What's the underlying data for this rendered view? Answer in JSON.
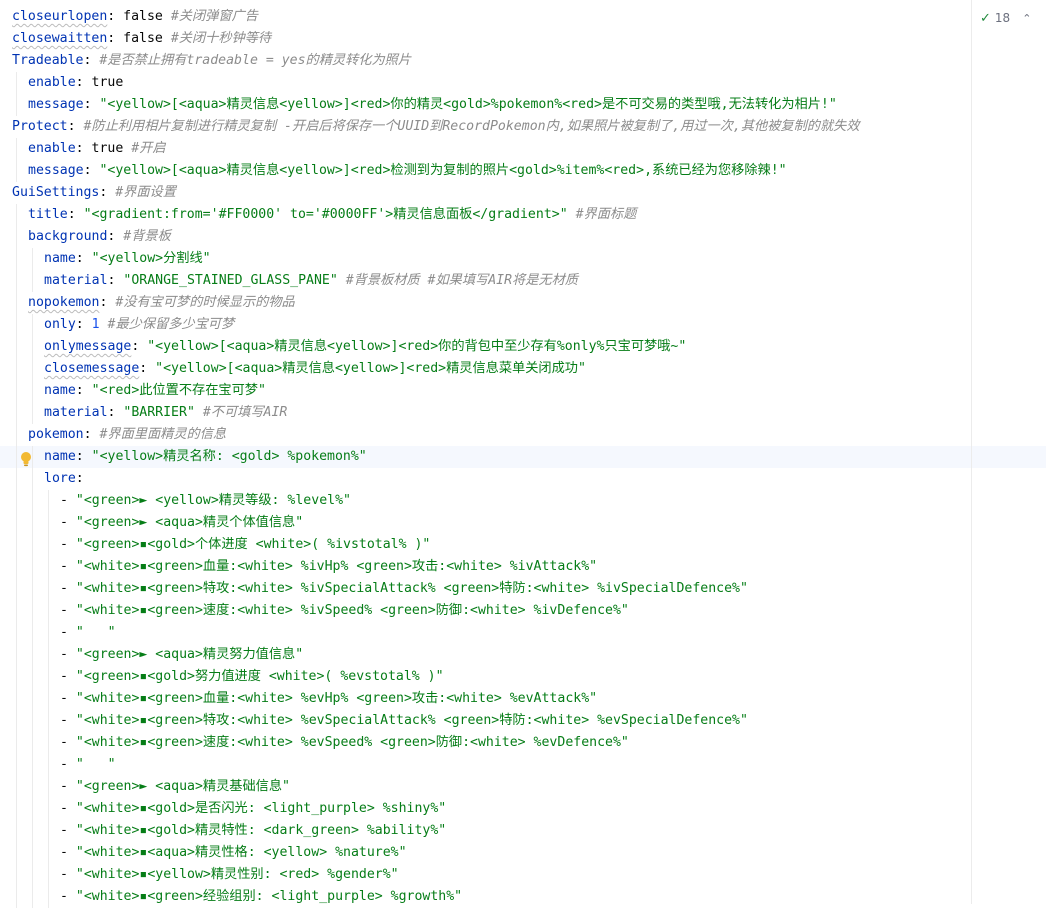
{
  "editor": {
    "inspection_count": "18",
    "lines": [
      {
        "indent": 0,
        "tokens": [
          {
            "t": "k",
            "v": "closeurlopen",
            "wavy": true
          },
          {
            "t": "v",
            "v": ": "
          },
          {
            "t": "v",
            "v": "false "
          },
          {
            "t": "c",
            "v": "#关闭弹窗广告"
          }
        ]
      },
      {
        "indent": 0,
        "tokens": [
          {
            "t": "k",
            "v": "closewaitten",
            "wavy": true
          },
          {
            "t": "v",
            "v": ": "
          },
          {
            "t": "v",
            "v": "false "
          },
          {
            "t": "c",
            "v": "#关闭十秒钟等待"
          }
        ]
      },
      {
        "indent": 0,
        "tokens": [
          {
            "t": "k",
            "v": "Tradeable"
          },
          {
            "t": "v",
            "v": ": "
          },
          {
            "t": "c",
            "v": "#是否禁止拥有tradeable = yes的精灵转化为照片"
          }
        ]
      },
      {
        "indent": 1,
        "tokens": [
          {
            "t": "k",
            "v": "enable"
          },
          {
            "t": "v",
            "v": ": "
          },
          {
            "t": "v",
            "v": "true"
          }
        ]
      },
      {
        "indent": 1,
        "tokens": [
          {
            "t": "k",
            "v": "message"
          },
          {
            "t": "v",
            "v": ": "
          },
          {
            "t": "s",
            "v": "\"<yellow>[<aqua>精灵信息<yellow>]<red>你的精灵<gold>%pokemon%<red>是不可交易的类型哦,无法转化为相片!\""
          }
        ]
      },
      {
        "indent": 0,
        "tokens": [
          {
            "t": "k",
            "v": "Protect"
          },
          {
            "t": "v",
            "v": ": "
          },
          {
            "t": "c",
            "v": "#防止利用相片复制进行精灵复制 -开启后将保存一个UUID到RecordPokemon内,如果照片被复制了,用过一次,其他被复制的就失效"
          }
        ]
      },
      {
        "indent": 1,
        "tokens": [
          {
            "t": "k",
            "v": "enable"
          },
          {
            "t": "v",
            "v": ": "
          },
          {
            "t": "v",
            "v": "true "
          },
          {
            "t": "c",
            "v": "#开启"
          }
        ]
      },
      {
        "indent": 1,
        "tokens": [
          {
            "t": "k",
            "v": "message"
          },
          {
            "t": "v",
            "v": ": "
          },
          {
            "t": "s",
            "v": "\"<yellow>[<aqua>精灵信息<yellow>]<red>检测到为复制的照片<gold>%item%<red>,系统已经为您移除辣!\""
          }
        ]
      },
      {
        "indent": 0,
        "tokens": [
          {
            "t": "k",
            "v": "GuiSettings"
          },
          {
            "t": "v",
            "v": ": "
          },
          {
            "t": "c",
            "v": "#界面设置"
          }
        ]
      },
      {
        "indent": 1,
        "tokens": [
          {
            "t": "k",
            "v": "title"
          },
          {
            "t": "v",
            "v": ": "
          },
          {
            "t": "s",
            "v": "\"<gradient:from='#FF0000' to='#0000FF'>精灵信息面板</gradient>\" "
          },
          {
            "t": "c",
            "v": "#界面标题"
          }
        ]
      },
      {
        "indent": 1,
        "tokens": [
          {
            "t": "k",
            "v": "background"
          },
          {
            "t": "v",
            "v": ": "
          },
          {
            "t": "c",
            "v": "#背景板"
          }
        ]
      },
      {
        "indent": 2,
        "tokens": [
          {
            "t": "k",
            "v": "name"
          },
          {
            "t": "v",
            "v": ": "
          },
          {
            "t": "s",
            "v": "\"<yellow>分割线\""
          }
        ]
      },
      {
        "indent": 2,
        "tokens": [
          {
            "t": "k",
            "v": "material"
          },
          {
            "t": "v",
            "v": ": "
          },
          {
            "t": "s",
            "v": "\"ORANGE_STAINED_GLASS_PANE\" "
          },
          {
            "t": "c",
            "v": "#背景板材质 #如果填写AIR将是无材质"
          }
        ]
      },
      {
        "indent": 1,
        "tokens": [
          {
            "t": "k",
            "v": "nopokemon",
            "wavy": true
          },
          {
            "t": "v",
            "v": ": "
          },
          {
            "t": "c",
            "v": "#没有宝可梦的时候显示的物品"
          }
        ]
      },
      {
        "indent": 2,
        "tokens": [
          {
            "t": "k",
            "v": "only"
          },
          {
            "t": "v",
            "v": ": "
          },
          {
            "t": "n",
            "v": "1 "
          },
          {
            "t": "c",
            "v": "#最少保留多少宝可梦"
          }
        ]
      },
      {
        "indent": 2,
        "tokens": [
          {
            "t": "k",
            "v": "onlymessage",
            "wavy": true
          },
          {
            "t": "v",
            "v": ": "
          },
          {
            "t": "s",
            "v": "\"<yellow>[<aqua>精灵信息<yellow>]<red>你的背包中至少存有%only%只宝可梦哦~\""
          }
        ]
      },
      {
        "indent": 2,
        "tokens": [
          {
            "t": "k",
            "v": "closemessage",
            "wavy": true
          },
          {
            "t": "v",
            "v": ": "
          },
          {
            "t": "s",
            "v": "\"<yellow>[<aqua>精灵信息<yellow>]<red>精灵信息菜单关闭成功\""
          }
        ]
      },
      {
        "indent": 2,
        "tokens": [
          {
            "t": "k",
            "v": "name"
          },
          {
            "t": "v",
            "v": ": "
          },
          {
            "t": "s",
            "v": "\"<red>此位置不存在宝可梦\""
          }
        ]
      },
      {
        "indent": 2,
        "tokens": [
          {
            "t": "k",
            "v": "material"
          },
          {
            "t": "v",
            "v": ": "
          },
          {
            "t": "s",
            "v": "\"BARRIER\" "
          },
          {
            "t": "c",
            "v": "#不可填写AIR"
          }
        ]
      },
      {
        "indent": 1,
        "tokens": [
          {
            "t": "k",
            "v": "pokemon"
          },
          {
            "t": "v",
            "v": ": "
          },
          {
            "t": "c",
            "v": "#界面里面精灵的信息"
          }
        ]
      },
      {
        "indent": 2,
        "current": true,
        "tokens": [
          {
            "t": "k",
            "v": "name"
          },
          {
            "t": "v",
            "v": ": "
          },
          {
            "t": "s",
            "v": "\"<yellow>精灵名称: <gold> %pokemon%\""
          }
        ]
      },
      {
        "indent": 2,
        "tokens": [
          {
            "t": "k",
            "v": "lore"
          },
          {
            "t": "v",
            "v": ":"
          }
        ]
      },
      {
        "indent": 3,
        "tokens": [
          {
            "t": "v",
            "v": "- "
          },
          {
            "t": "s",
            "v": "\"<green>► <yellow>精灵等级: %level%\""
          }
        ]
      },
      {
        "indent": 3,
        "tokens": [
          {
            "t": "v",
            "v": "- "
          },
          {
            "t": "s",
            "v": "\"<green>► <aqua>精灵个体值信息\""
          }
        ]
      },
      {
        "indent": 3,
        "tokens": [
          {
            "t": "v",
            "v": "- "
          },
          {
            "t": "s",
            "v": "\"<green>▪<gold>个体进度 <white>( %ivstotal% )\""
          }
        ]
      },
      {
        "indent": 3,
        "tokens": [
          {
            "t": "v",
            "v": "- "
          },
          {
            "t": "s",
            "v": "\"<white>▪<green>血量:<white> %ivHp% <green>攻击:<white> %ivAttack%\""
          }
        ]
      },
      {
        "indent": 3,
        "tokens": [
          {
            "t": "v",
            "v": "- "
          },
          {
            "t": "s",
            "v": "\"<white>▪<green>特攻:<white> %ivSpecialAttack% <green>特防:<white> %ivSpecialDefence%\""
          }
        ]
      },
      {
        "indent": 3,
        "tokens": [
          {
            "t": "v",
            "v": "- "
          },
          {
            "t": "s",
            "v": "\"<white>▪<green>速度:<white> %ivSpeed% <green>防御:<white> %ivDefence%\""
          }
        ]
      },
      {
        "indent": 3,
        "tokens": [
          {
            "t": "v",
            "v": "- "
          },
          {
            "t": "s",
            "v": "\"   \""
          }
        ]
      },
      {
        "indent": 3,
        "tokens": [
          {
            "t": "v",
            "v": "- "
          },
          {
            "t": "s",
            "v": "\"<green>► <aqua>精灵努力值信息\""
          }
        ]
      },
      {
        "indent": 3,
        "tokens": [
          {
            "t": "v",
            "v": "- "
          },
          {
            "t": "s",
            "v": "\"<green>▪<gold>努力值进度 <white>( %evstotal% )\""
          }
        ]
      },
      {
        "indent": 3,
        "tokens": [
          {
            "t": "v",
            "v": "- "
          },
          {
            "t": "s",
            "v": "\"<white>▪<green>血量:<white> %evHp% <green>攻击:<white> %evAttack%\""
          }
        ]
      },
      {
        "indent": 3,
        "tokens": [
          {
            "t": "v",
            "v": "- "
          },
          {
            "t": "s",
            "v": "\"<white>▪<green>特攻:<white> %evSpecialAttack% <green>特防:<white> %evSpecialDefence%\""
          }
        ]
      },
      {
        "indent": 3,
        "tokens": [
          {
            "t": "v",
            "v": "- "
          },
          {
            "t": "s",
            "v": "\"<white>▪<green>速度:<white> %evSpeed% <green>防御:<white> %evDefence%\""
          }
        ]
      },
      {
        "indent": 3,
        "tokens": [
          {
            "t": "v",
            "v": "- "
          },
          {
            "t": "s",
            "v": "\"   \""
          }
        ]
      },
      {
        "indent": 3,
        "tokens": [
          {
            "t": "v",
            "v": "- "
          },
          {
            "t": "s",
            "v": "\"<green>► <aqua>精灵基础信息\""
          }
        ]
      },
      {
        "indent": 3,
        "tokens": [
          {
            "t": "v",
            "v": "- "
          },
          {
            "t": "s",
            "v": "\"<white>▪<gold>是否闪光: <light_purple> %shiny%\""
          }
        ]
      },
      {
        "indent": 3,
        "tokens": [
          {
            "t": "v",
            "v": "- "
          },
          {
            "t": "s",
            "v": "\"<white>▪<gold>精灵特性: <dark_green> %ability%\""
          }
        ]
      },
      {
        "indent": 3,
        "tokens": [
          {
            "t": "v",
            "v": "- "
          },
          {
            "t": "s",
            "v": "\"<white>▪<aqua>精灵性格: <yellow> %nature%\""
          }
        ]
      },
      {
        "indent": 3,
        "tokens": [
          {
            "t": "v",
            "v": "- "
          },
          {
            "t": "s",
            "v": "\"<white>▪<yellow>精灵性别: <red> %gender%\""
          }
        ]
      },
      {
        "indent": 3,
        "tokens": [
          {
            "t": "v",
            "v": "- "
          },
          {
            "t": "s",
            "v": "\"<white>▪<green>经验组别: <light_purple> %growth%\""
          }
        ]
      }
    ]
  }
}
